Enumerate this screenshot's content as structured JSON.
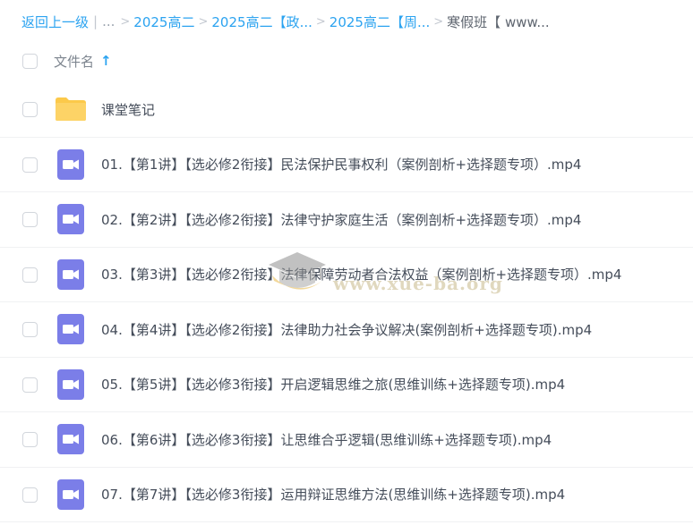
{
  "breadcrumb": {
    "back": "返回上一级",
    "ellipsis": "...",
    "items": [
      "2025高二",
      "2025高二【政...",
      "2025高二【周..."
    ],
    "current": "寒假班【 www..."
  },
  "header": {
    "column_label": "文件名",
    "sort_icon": "arrow-up-icon"
  },
  "files": [
    {
      "name": "课堂笔记",
      "type": "folder"
    },
    {
      "name": "01.【第1讲】【选必修2衔接】民法保护民事权利（案例剖析+选择题专项）.mp4",
      "type": "video"
    },
    {
      "name": "02.【第2讲】【选必修2衔接】法律守护家庭生活（案例剖析+选择题专项）.mp4",
      "type": "video"
    },
    {
      "name": "03.【第3讲】【选必修2衔接】法律保障劳动者合法权益（案例剖析+选择题专项）.mp4",
      "type": "video"
    },
    {
      "name": "04.【第4讲】【选必修2衔接】法律助力社会争议解决(案例剖析+选择题专项).mp4",
      "type": "video"
    },
    {
      "name": "05.【第5讲】【选必修3衔接】开启逻辑思维之旅(思维训练+选择题专项).mp4",
      "type": "video"
    },
    {
      "name": "06.【第6讲】【选必修3衔接】让思维合乎逻辑(思维训练+选择题专项).mp4",
      "type": "video"
    },
    {
      "name": "07.【第7讲】【选必修3衔接】运用辩证思维方法(思维训练+选择题专项).mp4",
      "type": "video"
    }
  ],
  "watermark": {
    "text": "www.xue-ba.org"
  },
  "colors": {
    "link": "#2ba3f0",
    "folder": "#fcc94a",
    "video": "#7b7ee8"
  }
}
